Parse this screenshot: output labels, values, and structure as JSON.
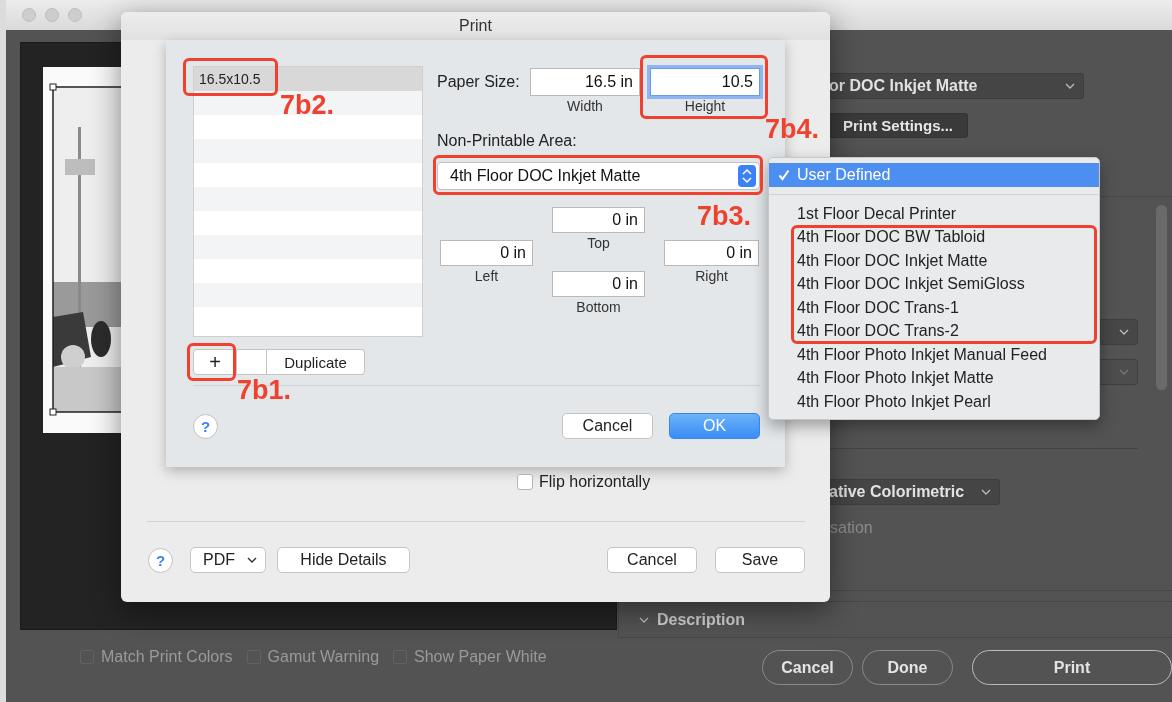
{
  "photoshop_window": {
    "preview": {
      "kind": "picture"
    },
    "preview_options": [
      {
        "label": "Match Print Colors",
        "checked": false,
        "disabled": true
      },
      {
        "label": "Gamut Warning",
        "checked": false,
        "disabled": true
      },
      {
        "label": "Show Paper White",
        "checked": false,
        "disabled": true
      }
    ],
    "printer_value": "or DOC Inkjet Matte",
    "print_settings_button": "Print Settings...",
    "rendering_intent_value": "ative Colorimetric",
    "partial_option": "sation",
    "description_section": "Description",
    "buttons": [
      "Cancel",
      "Done",
      "Print"
    ]
  },
  "print_dialog": {
    "title": "Print",
    "flip_horizontally": {
      "label": "Flip horizontally",
      "checked": false
    },
    "help": "?",
    "pdf_menu": "PDF",
    "left_buttons": [
      "Hide Details"
    ],
    "right_buttons": [
      "Cancel",
      "Save"
    ]
  },
  "custom_paper_sizes": {
    "sizes": [
      {
        "name": "16.5x10.5",
        "selected": true
      }
    ],
    "add_button": "+",
    "duplicate_button": "Duplicate",
    "paper_size_label": "Paper Size:",
    "width": {
      "value": "16.5 in",
      "label": "Width",
      "focused": false
    },
    "height": {
      "value": "10.5",
      "label": "Height",
      "focused": true
    },
    "non_printable_label": "Non-Printable Area:",
    "non_printable_value": "4th Floor DOC Inkjet Matte",
    "margins": {
      "top": {
        "value": "0 in",
        "label": "Top"
      },
      "left": {
        "value": "0 in",
        "label": "Left"
      },
      "right": {
        "value": "0 in",
        "label": "Right"
      },
      "bottom": {
        "value": "0 in",
        "label": "Bottom"
      }
    },
    "help": "?",
    "buttons": [
      {
        "label": "Cancel",
        "default": false
      },
      {
        "label": "OK",
        "default": true
      }
    ]
  },
  "non_printable_menu": {
    "items": [
      {
        "kind": "option",
        "label": "User Defined",
        "selected": true
      },
      {
        "kind": "separator"
      },
      {
        "kind": "option",
        "label": "1st Floor Decal Printer",
        "selected": false
      },
      {
        "kind": "option",
        "label": "4th Floor DOC BW Tabloid",
        "selected": false
      },
      {
        "kind": "option",
        "label": "4th Floor DOC Inkjet Matte",
        "selected": false
      },
      {
        "kind": "option",
        "label": "4th Floor DOC Inkjet SemiGloss",
        "selected": false
      },
      {
        "kind": "option",
        "label": "4th Floor DOC Trans-1",
        "selected": false
      },
      {
        "kind": "option",
        "label": "4th Floor DOC Trans-2",
        "selected": false
      },
      {
        "kind": "option",
        "label": "4th Floor Photo Inkjet Manual Feed",
        "selected": false
      },
      {
        "kind": "option",
        "label": "4th Floor Photo Inkjet Matte",
        "selected": false
      },
      {
        "kind": "option",
        "label": "4th Floor Photo Inkjet Pearl",
        "selected": false
      }
    ]
  },
  "annotations": [
    {
      "label": "7b2."
    },
    {
      "label": "7b4."
    },
    {
      "label": "7b3."
    },
    {
      "label": "7b1."
    }
  ]
}
